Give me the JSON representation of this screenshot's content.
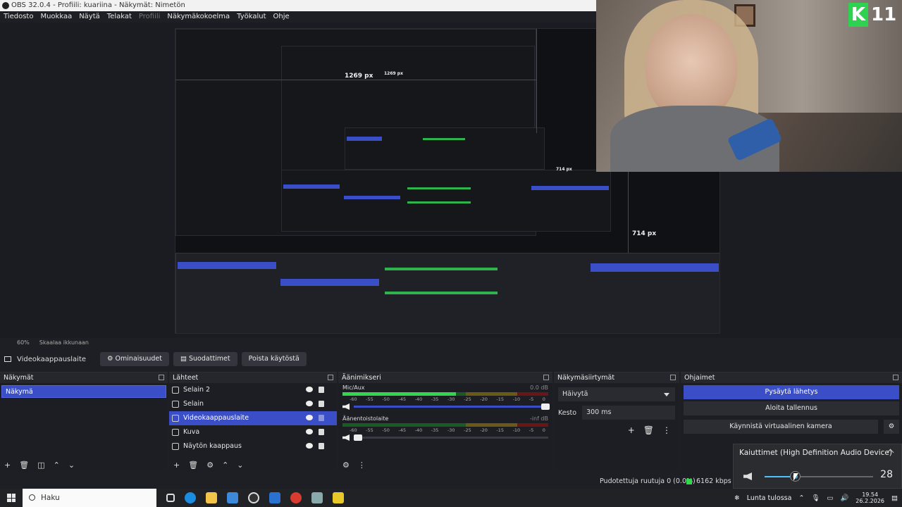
{
  "window": {
    "title": "OBS 32.0.4 - Profiili: kuariina - Näkymät: Nimetön"
  },
  "menu": [
    "Tiedosto",
    "Muokkaa",
    "Näytä",
    "Telakat",
    "Profiili",
    "Näkymäkokoelma",
    "Työkalut",
    "Ohje"
  ],
  "preview": {
    "label_horizontal": "1269 px",
    "label_vertical": "714 px",
    "label_nested_1": "1269 px",
    "label_nested_2": "714 px"
  },
  "badge": {
    "letter": "K",
    "number": "11"
  },
  "scalebar": {
    "zoom": "60%",
    "scale_label": "Skaalaa ikkunaan"
  },
  "source_toolbar": {
    "selected_source": "Videokaappauslaite",
    "properties": "Ominaisuudet",
    "filters": "Suodattimet",
    "disable": "Poista käytöstä"
  },
  "docks": {
    "scenes": {
      "title": "Näkymät",
      "items": [
        "Näkymä"
      ]
    },
    "sources": {
      "title": "Lähteet",
      "items": [
        "Selain 2",
        "Selain",
        "Videokaappauslaite",
        "Kuva",
        "Näytön kaappaus"
      ],
      "selected_index": 2
    },
    "mixer": {
      "title": "Äänimikseri",
      "channels": [
        {
          "name": "Mic/Aux",
          "db": "0.0 dB",
          "level": 0.55
        },
        {
          "name": "Äänentoistolaite",
          "db": "-inf dB",
          "level": 0
        }
      ],
      "scale": [
        "-60",
        "-55",
        "-50",
        "-45",
        "-40",
        "-35",
        "-30",
        "-25",
        "-20",
        "-15",
        "-10",
        "-5",
        "0"
      ]
    },
    "transitions": {
      "title": "Näkymäsiirtymät",
      "selected": "Häivytä",
      "duration_label": "Kesto",
      "duration_value": "300 ms"
    },
    "controls": {
      "title": "Ohjaimet",
      "buttons": [
        "Pysäytä lähetys",
        "Aloita tallennus",
        "Käynnistä virtuaalinen kamera"
      ]
    }
  },
  "status": {
    "dropped": "Pudotettuja ruutuja 0 (0.0%)",
    "bitrate": "6162 kbps"
  },
  "volume_flyout": {
    "device": "Kaiuttimet (High Definition Audio Device)",
    "value": "28",
    "level": 0.28
  },
  "taskbar": {
    "search_placeholder": "Haku",
    "weather": "Lunta tulossa",
    "time": "19.54",
    "date": "26.2.2026"
  },
  "colors": {
    "accent": "#3a4fc7",
    "meter_green": "#32d74b",
    "redline": "#d01010",
    "badge_green": "#2fd150"
  }
}
